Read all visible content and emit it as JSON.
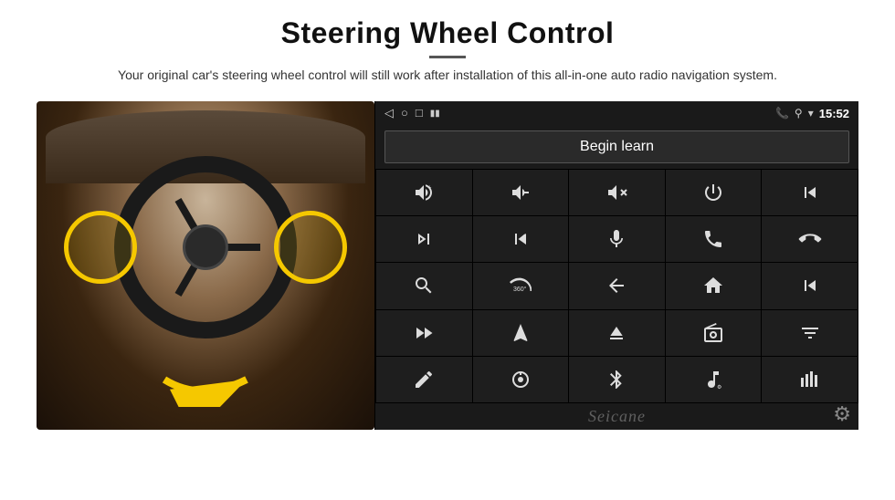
{
  "page": {
    "title": "Steering Wheel Control",
    "divider": "",
    "subtitle": "Your original car's steering wheel control will still work after installation of this all-in-one auto radio navigation system."
  },
  "screen": {
    "status_bar": {
      "back_icon": "◁",
      "home_icon": "○",
      "recent_icon": "□",
      "signal_icon": "▮▮",
      "phone_icon": "📞",
      "location_icon": "⚲",
      "wifi_icon": "▾",
      "time": "15:52"
    },
    "begin_learn_label": "Begin learn",
    "seicane_label": "Seicane"
  },
  "controls": [
    {
      "icon": "vol_up",
      "row": 1
    },
    {
      "icon": "vol_down",
      "row": 1
    },
    {
      "icon": "mute",
      "row": 1
    },
    {
      "icon": "power",
      "row": 1
    },
    {
      "icon": "prev_track",
      "row": 1
    },
    {
      "icon": "skip_forward",
      "row": 2
    },
    {
      "icon": "skip_prev_fast",
      "row": 2
    },
    {
      "icon": "mic",
      "row": 2
    },
    {
      "icon": "phone",
      "row": 2
    },
    {
      "icon": "hang_up",
      "row": 2
    },
    {
      "icon": "cam",
      "row": 3
    },
    {
      "icon": "360",
      "row": 3
    },
    {
      "icon": "back",
      "row": 3
    },
    {
      "icon": "home2",
      "row": 3
    },
    {
      "icon": "prev_ch",
      "row": 3
    },
    {
      "icon": "skip_fwd2",
      "row": 4
    },
    {
      "icon": "nav",
      "row": 4
    },
    {
      "icon": "eject",
      "row": 4
    },
    {
      "icon": "radio",
      "row": 4
    },
    {
      "icon": "eq",
      "row": 4
    },
    {
      "icon": "pen",
      "row": 5
    },
    {
      "icon": "settings_knob",
      "row": 5
    },
    {
      "icon": "bluetooth",
      "row": 5
    },
    {
      "icon": "music",
      "row": 5
    },
    {
      "icon": "spectrum",
      "row": 5
    }
  ]
}
